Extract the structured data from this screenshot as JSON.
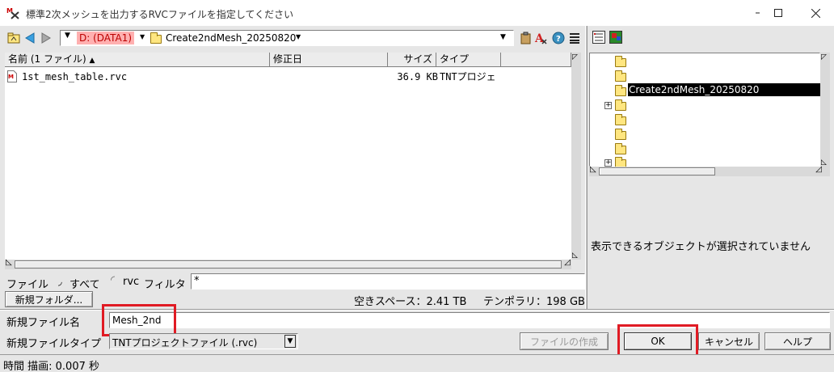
{
  "window": {
    "title": "標準2次メッシュを出力するRVCファイルを指定してください",
    "minimize_icon": "minimize-icon",
    "maximize_icon": "maximize-icon",
    "close_icon": "close-icon"
  },
  "toolbar": {
    "drive_label": "D: (DATA1)",
    "folder_label": "Create2ndMesh_20250820"
  },
  "file_list": {
    "columns": {
      "name": "名前 (1 ファイル)",
      "modified": "修正日",
      "size": "サイズ",
      "type": "タイプ"
    },
    "rows": [
      {
        "name": "1st_mesh_table.rvc",
        "size": "36.9 KB",
        "type": "TNTプロジェ"
      }
    ]
  },
  "filter": {
    "label": "ファイル",
    "option_all": "すべて",
    "option_rvc": "rvc",
    "filter_label": "フィルタ",
    "filter_value": "*"
  },
  "new_folder_button": "新規フォルダ...",
  "free_space": "空きスペース：2.41 TB",
  "temp_space": "テンポラリ：198 GB",
  "tree": {
    "selected_label": "Create2ndMesh_20250820",
    "status_message": "表示できるオブジェクトが選択されていません"
  },
  "new_file": {
    "label": "新規ファイル名",
    "value": "Mesh_2nd"
  },
  "file_type": {
    "label": "新規ファイルタイプ",
    "value": "TNTプロジェクトファイル (.rvc)"
  },
  "buttons": {
    "create_file": "ファイルの作成",
    "ok": "OK",
    "cancel": "キャンセル",
    "help": "ヘルプ"
  },
  "status_bar": "時間 描画: 0.007 秒"
}
